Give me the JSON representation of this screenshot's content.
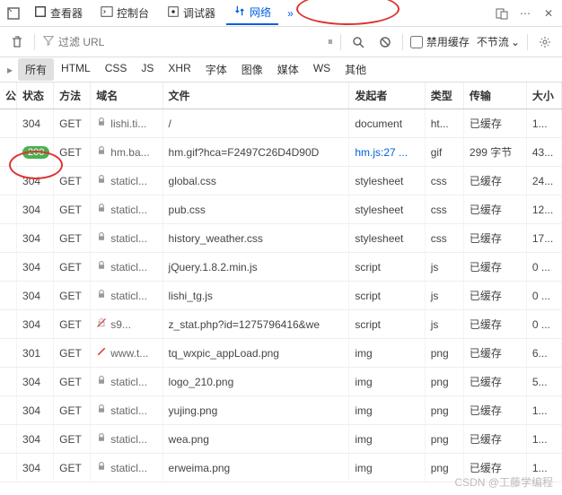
{
  "topTabs": {
    "inspector": "查看器",
    "console": "控制台",
    "debugger": "调试器",
    "network": "网络",
    "overflow": "»"
  },
  "toolbar": {
    "filterPlaceholder": "过滤 URL",
    "disableCache": "禁用缓存",
    "throttle": "不节流",
    "pause": "⏸"
  },
  "filterTabs": [
    "所有",
    "HTML",
    "CSS",
    "JS",
    "XHR",
    "字体",
    "图像",
    "媒体",
    "WS",
    "其他"
  ],
  "columns": {
    "pub": "公",
    "status": "状态",
    "method": "方法",
    "domain": "域名",
    "file": "文件",
    "initiator": "发起者",
    "type": "类型",
    "transfer": "传输",
    "size": "大小"
  },
  "rows": [
    {
      "status": "304",
      "method": "GET",
      "domain": "lishi.ti...",
      "domainIcon": "lock",
      "file": "/",
      "initiator": "document",
      "type": "ht...",
      "transfer": "已缓存",
      "size": "1..."
    },
    {
      "status": "200",
      "statusBadge": true,
      "method": "GET",
      "domain": "hm.ba...",
      "domainIcon": "lock",
      "file": "hm.gif?hca=F2497C26D4D90D",
      "initiator": "hm.js:27 ...",
      "initiatorLink": true,
      "type": "gif",
      "transfer": "299 字节",
      "size": "43..."
    },
    {
      "status": "304",
      "method": "GET",
      "domain": "staticl...",
      "domainIcon": "lock",
      "file": "global.css",
      "initiator": "stylesheet",
      "type": "css",
      "transfer": "已缓存",
      "size": "24..."
    },
    {
      "status": "304",
      "method": "GET",
      "domain": "staticl...",
      "domainIcon": "lock",
      "file": "pub.css",
      "initiator": "stylesheet",
      "type": "css",
      "transfer": "已缓存",
      "size": "12..."
    },
    {
      "status": "304",
      "method": "GET",
      "domain": "staticl...",
      "domainIcon": "lock",
      "file": "history_weather.css",
      "initiator": "stylesheet",
      "type": "css",
      "transfer": "已缓存",
      "size": "17..."
    },
    {
      "status": "304",
      "method": "GET",
      "domain": "staticl...",
      "domainIcon": "lock",
      "file": "jQuery.1.8.2.min.js",
      "initiator": "script",
      "type": "js",
      "transfer": "已缓存",
      "size": "0 ..."
    },
    {
      "status": "304",
      "method": "GET",
      "domain": "staticl...",
      "domainIcon": "lock",
      "file": "lishi_tg.js",
      "initiator": "script",
      "type": "js",
      "transfer": "已缓存",
      "size": "0 ..."
    },
    {
      "status": "304",
      "method": "GET",
      "domain": "s9...",
      "domainIcon": "nolock",
      "file": "z_stat.php?id=1275796416&we",
      "initiator": "script",
      "type": "js",
      "transfer": "已缓存",
      "size": "0 ..."
    },
    {
      "status": "301",
      "method": "GET",
      "domain": "www.t...",
      "domainIcon": "slash",
      "file": "tq_wxpic_appLoad.png",
      "initiator": "img",
      "type": "png",
      "transfer": "已缓存",
      "size": "6..."
    },
    {
      "status": "304",
      "method": "GET",
      "domain": "staticl...",
      "domainIcon": "lock",
      "file": "logo_210.png",
      "initiator": "img",
      "type": "png",
      "transfer": "已缓存",
      "size": "5..."
    },
    {
      "status": "304",
      "method": "GET",
      "domain": "staticl...",
      "domainIcon": "lock",
      "file": "yujing.png",
      "initiator": "img",
      "type": "png",
      "transfer": "已缓存",
      "size": "1..."
    },
    {
      "status": "304",
      "method": "GET",
      "domain": "staticl...",
      "domainIcon": "lock",
      "file": "wea.png",
      "initiator": "img",
      "type": "png",
      "transfer": "已缓存",
      "size": "1..."
    },
    {
      "status": "304",
      "method": "GET",
      "domain": "staticl...",
      "domainIcon": "lock",
      "file": "erweima.png",
      "initiator": "img",
      "type": "png",
      "transfer": "已缓存",
      "size": "1..."
    }
  ],
  "watermark": "CSDN @工藤学编程"
}
